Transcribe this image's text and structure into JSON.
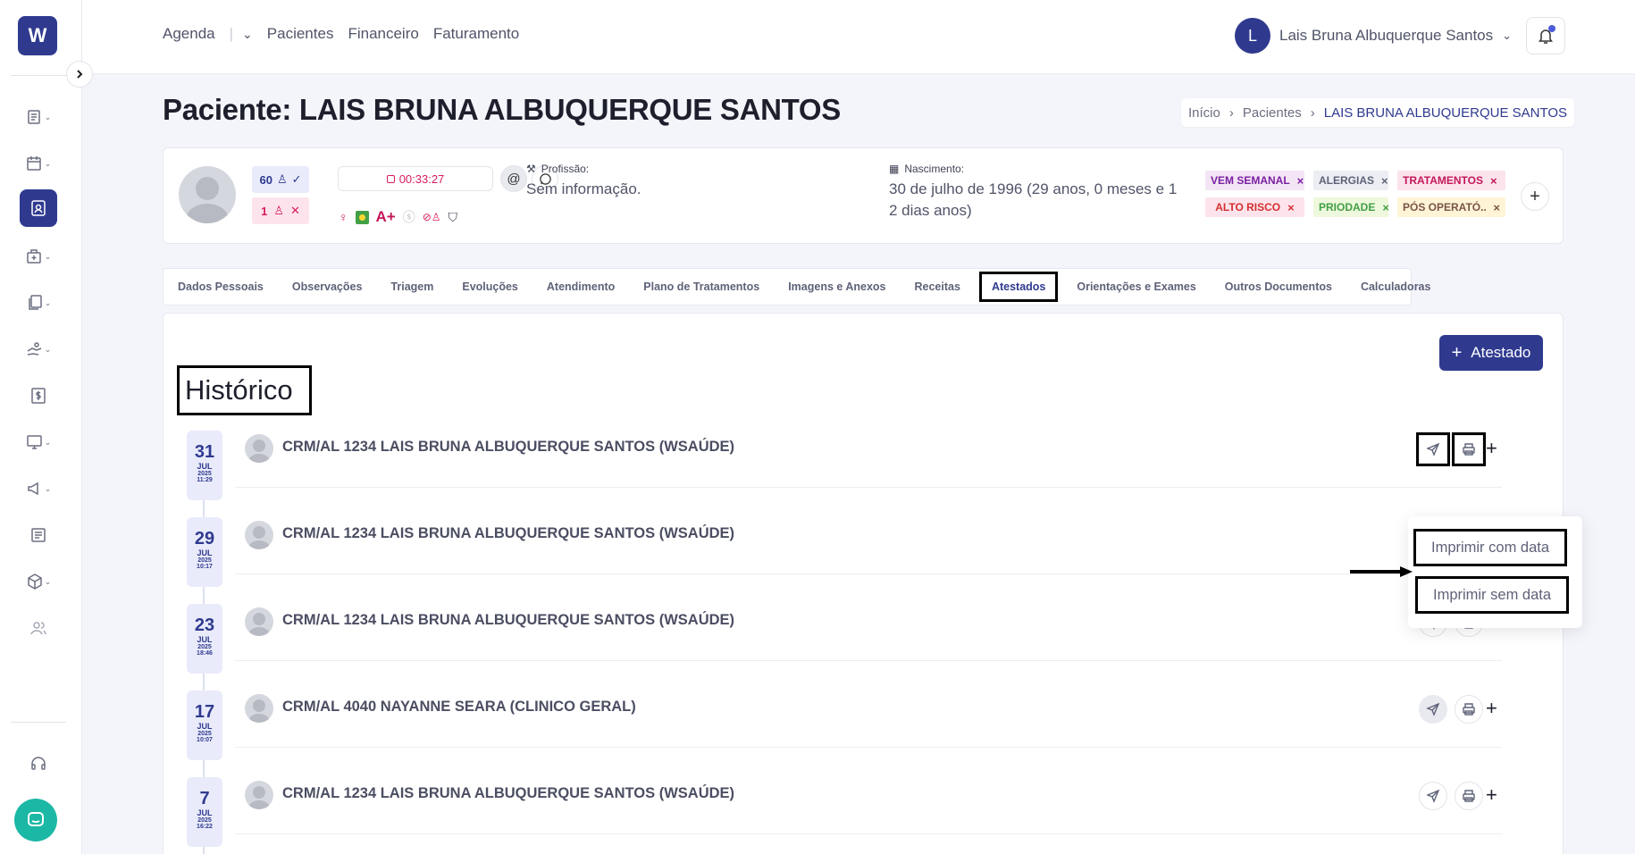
{
  "app": {
    "logo_letter": "W"
  },
  "nav": {
    "items": [
      "Agenda",
      "Pacientes",
      "Financeiro",
      "Faturamento"
    ],
    "agenda_separator": "|",
    "agenda_caret": "⌄"
  },
  "user": {
    "initial": "L",
    "name": "Lais Bruna Albuquerque Santos"
  },
  "page": {
    "title": "Paciente: LAIS BRUNA ALBUQUERQUE SANTOS",
    "breadcrumb": [
      "Início",
      "Pacientes",
      "LAIS BRUNA ALBUQUERQUE SANTOS"
    ]
  },
  "patient": {
    "attended_count": "60",
    "missed_count": "1",
    "timer": "00:33:27",
    "blood_type": "A+",
    "profession_label": "Profissão:",
    "profession_value": "Sem informação.",
    "birth_label": "Nascimento:",
    "birth_value": "30 de julho de 1996 (29 anos, 0 meses e 1 2 dias anos)",
    "tags": [
      {
        "label": "VEM SEMANAL",
        "color": "#7b1fa2",
        "bg": "#f3e5f5"
      },
      {
        "label": "ALERGIAS",
        "color": "#5e6278",
        "bg": "#eceef3"
      },
      {
        "label": "TRATAMENTOS",
        "color": "#c2185b",
        "bg": "#fce4ec"
      },
      {
        "label": "ALTO RISCO",
        "color": "#d32f2f",
        "bg": "#fde4ec"
      },
      {
        "label": "PRIODADE",
        "color": "#43a047",
        "bg": "#eef8dc"
      },
      {
        "label": "PÓS OPERATÓ...",
        "color": "#795548",
        "bg": "#fff4d6"
      }
    ],
    "tag_remove": "×",
    "add_tag": "+"
  },
  "tabs": [
    "Dados Pessoais",
    "Observações",
    "Triagem",
    "Evoluções",
    "Atendimento",
    "Plano de Tratamentos",
    "Imagens e Anexos",
    "Receitas",
    "Atestados",
    "Orientações e Exames",
    "Outros Documentos",
    "Calculadoras"
  ],
  "active_tab": "Atestados",
  "content": {
    "add_button": "Atestado",
    "add_icon": "+",
    "history_title": "Histórico",
    "entries": [
      {
        "day": "31",
        "month": "JUL",
        "year": "2025",
        "time": "11:29",
        "text": "CRM/AL 1234 LAIS BRUNA ALBUQUERQUE SANTOS (WSAÚDE)",
        "send_disabled": false
      },
      {
        "day": "29",
        "month": "JUL",
        "year": "2025",
        "time": "10:17",
        "text": "CRM/AL 1234 LAIS BRUNA ALBUQUERQUE SANTOS (WSAÚDE)",
        "send_disabled": false
      },
      {
        "day": "23",
        "month": "JUL",
        "year": "2025",
        "time": "18:46",
        "text": "CRM/AL 1234 LAIS BRUNA ALBUQUERQUE SANTOS (WSAÚDE)",
        "send_disabled": false
      },
      {
        "day": "17",
        "month": "JUL",
        "year": "2025",
        "time": "10:07",
        "text": "CRM/AL 4040 NAYANNE SEARA (CLINICO GERAL)",
        "send_disabled": true
      },
      {
        "day": "7",
        "month": "JUL",
        "year": "2025",
        "time": "16:22",
        "text": "CRM/AL 1234 LAIS BRUNA ALBUQUERQUE SANTOS (WSAÚDE)",
        "send_disabled": false
      }
    ],
    "row_plus": "+"
  },
  "print_menu": {
    "with_date": "Imprimir com data",
    "without_date": "Imprimir sem data"
  },
  "colors": {
    "primary": "#2f3a8f",
    "chat": "#1bb8a5",
    "danger": "#d81b60"
  }
}
